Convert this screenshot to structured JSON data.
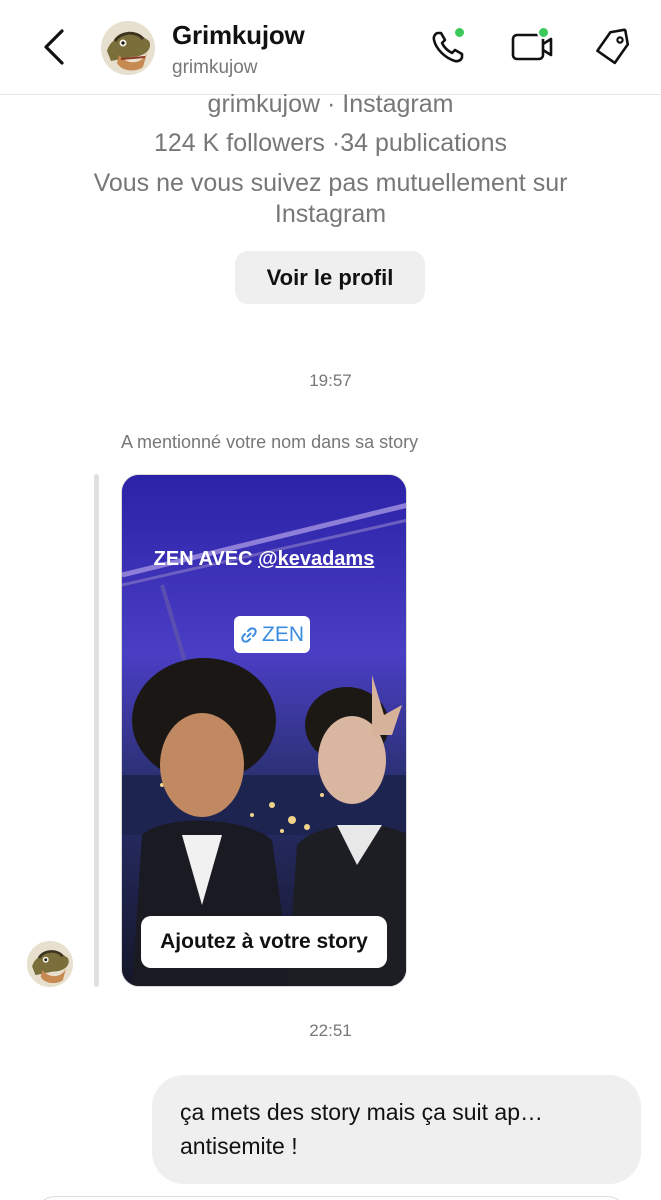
{
  "header": {
    "name": "Grimkujow",
    "username": "grimkujow",
    "icons": [
      "back-icon",
      "phone-icon",
      "video-icon",
      "tag-icon"
    ],
    "online_color": "#3dc85b"
  },
  "profile": {
    "line1": "grimkujow · Instagram",
    "line2": "124 K followers ·34 publications",
    "line3": "Vous ne vous suivez pas mutuellement sur Instagram",
    "view_profile_label": "Voir le profil"
  },
  "conversation": {
    "timestamp1": "19:57",
    "mention_label": "A mentionné votre nom dans sa story",
    "story": {
      "caption_prefix": "ZEN AVEC ",
      "caption_handle": "@kevadams",
      "link_sticker": "ZEN",
      "add_button": "Ajoutez à votre story"
    },
    "timestamp2": "22:51",
    "sent_message": {
      "line1": "ça mets des story mais ça suit ap…",
      "line2": "antisemite !"
    }
  }
}
